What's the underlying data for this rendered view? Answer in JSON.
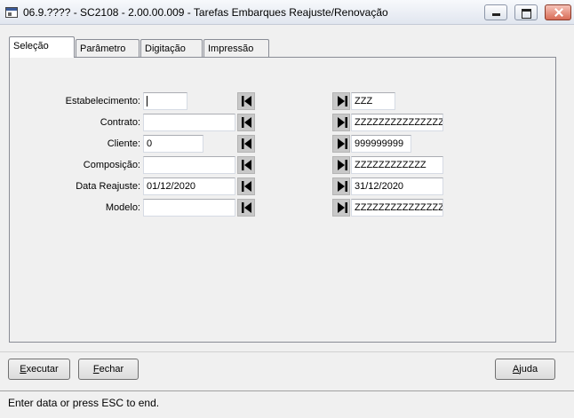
{
  "window": {
    "title": "06.9.???? - SC2108 - 2.00.00.009 - Tarefas Embarques Reajuste/Renovação"
  },
  "tabs": [
    {
      "label": "Seleção",
      "active": true
    },
    {
      "label": "Parâmetro",
      "active": false
    },
    {
      "label": "Digitação",
      "active": false
    },
    {
      "label": "Impressão",
      "active": false
    }
  ],
  "form": {
    "rows": [
      {
        "label": "Estabelecimento:",
        "start": "",
        "end": "ZZZ"
      },
      {
        "label": "Contrato:",
        "start": "",
        "end": "ZZZZZZZZZZZZZZZ"
      },
      {
        "label": "Cliente:",
        "start": "0",
        "end": "999999999"
      },
      {
        "label": "Composição:",
        "start": "",
        "end": "ZZZZZZZZZZZZ"
      },
      {
        "label": "Data Reajuste:",
        "start": "01/12/2020",
        "end": "31/12/2020"
      },
      {
        "label": "Modelo:",
        "start": "",
        "end": "ZZZZZZZZZZZZZZZ"
      }
    ],
    "first_icon": "first-record-icon",
    "last_icon": "last-record-icon"
  },
  "buttons": {
    "executar": {
      "mnemonic": "E",
      "rest": "xecutar"
    },
    "fechar": {
      "mnemonic": "F",
      "rest": "echar"
    },
    "ajuda": {
      "mnemonic": "A",
      "rest": "juda"
    }
  },
  "status": {
    "text": "Enter data or press ESC to end."
  }
}
